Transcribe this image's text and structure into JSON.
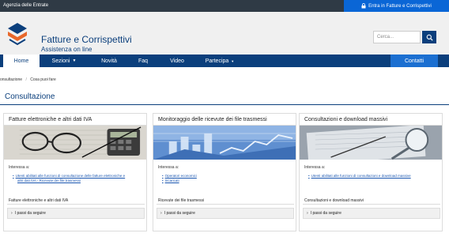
{
  "topbar": {
    "agency": "Agenzia delle Entrate",
    "login_label": "Entra in Fatture e Corrispettivi"
  },
  "header": {
    "title": "Fatture e Corrispettivi",
    "subtitle": "Assistenza on line",
    "search_placeholder": "Cerca..."
  },
  "nav": {
    "home": "Home",
    "sezioni": "Sezioni",
    "novita": "Novità",
    "faq": "Faq",
    "video": "Video",
    "partecipa": "Partecipa",
    "contatti": "Contatti"
  },
  "breadcrumb": [
    "onsultazione",
    "/",
    "Cosa puoi fare"
  ],
  "page_title": "Consultazione",
  "cards": [
    {
      "title": "Fatture elettroniche e altri dati IVA",
      "interest": "Interessa a:",
      "links": [
        "Utenti abilitati alle funzioni di consultazione delle fatture elettroniche e",
        "altri dati IVA - Ricevute dei file trasmessi"
      ],
      "section": "Fatture elettroniche e altri dati IVA",
      "steps": "I passi da seguire"
    },
    {
      "title": "Monitoraggio delle ricevute dei file trasmessi",
      "interest": "Interessa a:",
      "links": [
        "Operatori economici",
        "Incaricati"
      ],
      "section": "Ricevute dei file trasmessi",
      "steps": "I passi da seguire"
    },
    {
      "title": "Consultazioni e download massivi",
      "interest": "Interessa a:",
      "links": [
        "Utenti abilitati alle funzioni di consultazioni e download massive"
      ],
      "section": "Consultazioni e download massivi",
      "steps": "I passi da seguire"
    }
  ],
  "colors": {
    "brand": "#0b3f7c",
    "accent": "#1b6fd1",
    "login": "#0a66d6",
    "topbar": "#2f3a45"
  }
}
